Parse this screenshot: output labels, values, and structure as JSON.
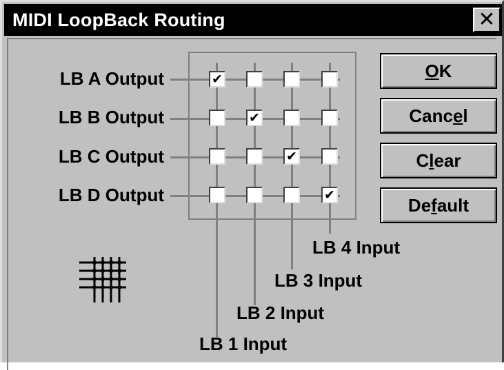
{
  "window": {
    "title": "MIDI LoopBack Routing",
    "close_glyph": "✕"
  },
  "outputs": [
    {
      "label": "LB A Output"
    },
    {
      "label": "LB B Output"
    },
    {
      "label": "LB C Output"
    },
    {
      "label": "LB D Output"
    }
  ],
  "inputs": [
    {
      "label": "LB 1 Input"
    },
    {
      "label": "LB 2 Input"
    },
    {
      "label": "LB 3 Input"
    },
    {
      "label": "LB 4 Input"
    }
  ],
  "matrix": [
    [
      true,
      false,
      false,
      false
    ],
    [
      false,
      true,
      false,
      false
    ],
    [
      false,
      false,
      true,
      false
    ],
    [
      false,
      false,
      false,
      true
    ]
  ],
  "buttons": {
    "ok": {
      "before": "",
      "mnemonic": "O",
      "after": "K"
    },
    "cancel": {
      "before": "Canc",
      "mnemonic": "e",
      "after": "l"
    },
    "clear": {
      "before": "C",
      "mnemonic": "l",
      "after": "ear"
    },
    "default": {
      "before": "De",
      "mnemonic": "f",
      "after": "ault"
    }
  },
  "icons": {
    "close": "close-icon",
    "routing": "routing-matrix-icon",
    "check": "✔"
  },
  "colors": {
    "titlebar": "#000000",
    "face": "#c0c0c0",
    "shadow": "#808080"
  }
}
